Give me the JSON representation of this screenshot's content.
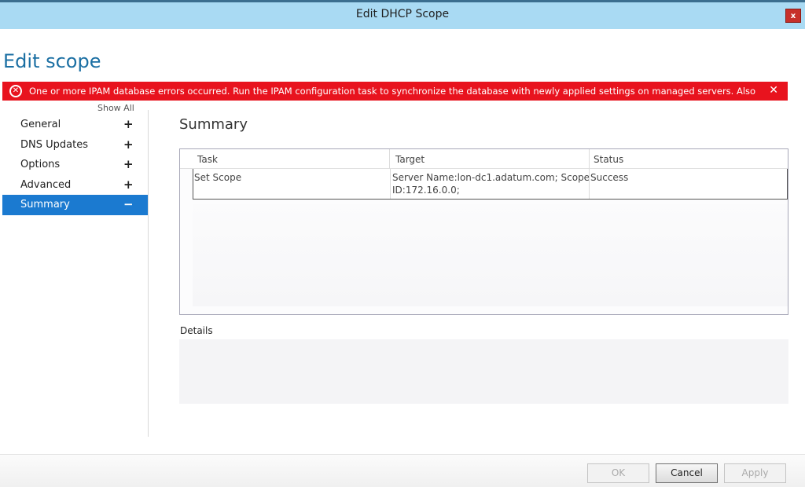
{
  "window": {
    "title": "Edit DHCP Scope",
    "close_glyph": "x"
  },
  "heading": "Edit scope",
  "error": {
    "text": "One or more IPAM database errors occurred. Run the IPAM configuration task to synchronize the database with newly applied settings on managed servers. Also en",
    "icon": "error-circle-icon",
    "close_glyph": "✕"
  },
  "nav": {
    "show_all": "Show All",
    "items": [
      {
        "label": "General",
        "toggle": "+"
      },
      {
        "label": "DNS Updates",
        "toggle": "+"
      },
      {
        "label": "Options",
        "toggle": "+"
      },
      {
        "label": "Advanced",
        "toggle": "+"
      },
      {
        "label": "Summary",
        "toggle": "−",
        "active": true
      }
    ]
  },
  "summary": {
    "title": "Summary",
    "columns": [
      "Task",
      "Target",
      "Status"
    ],
    "rows": [
      {
        "task": "Set Scope",
        "target_line1": "Server Name:lon-dc1.adatum.com; Scope",
        "target_line2": "ID:172.16.0.0;",
        "status": "Success"
      }
    ],
    "details_label": "Details"
  },
  "buttons": {
    "ok": "OK",
    "cancel": "Cancel",
    "apply": "Apply"
  },
  "colors": {
    "accent": "#1b7ad0",
    "error": "#e8131e",
    "titlebar": "#a9daf3",
    "heading": "#1b6fa3"
  }
}
